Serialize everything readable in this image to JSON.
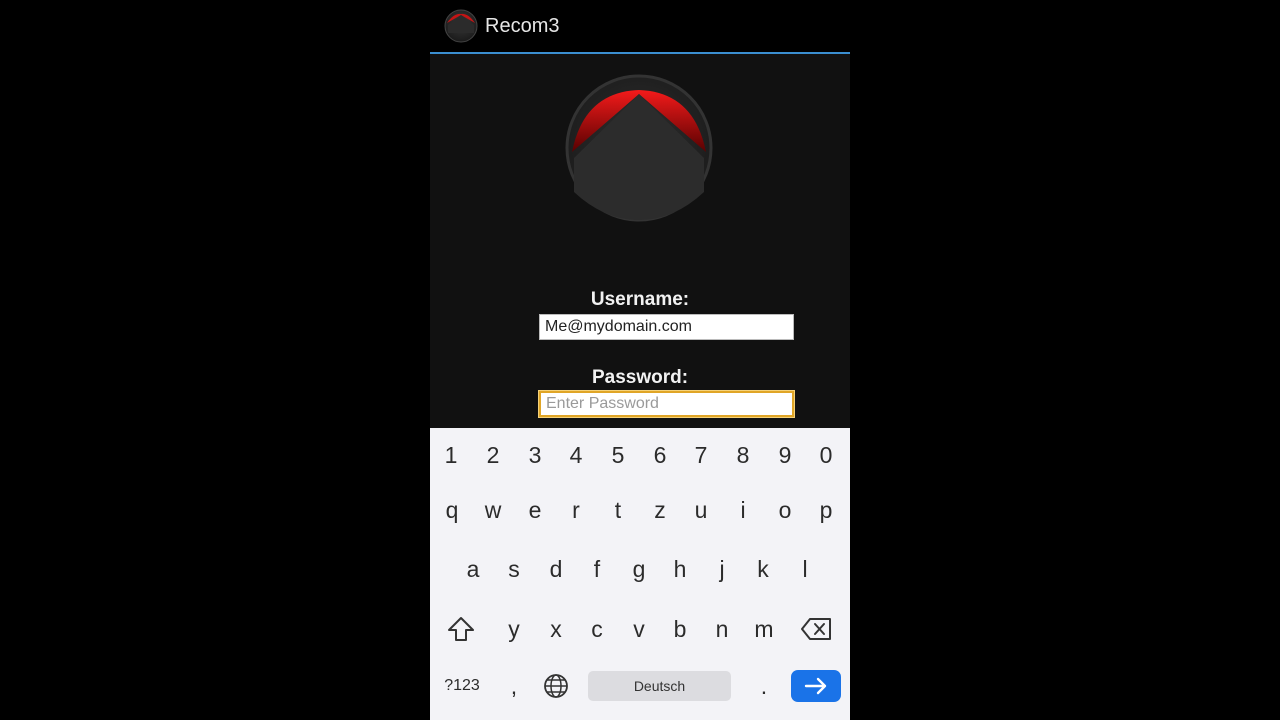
{
  "app": {
    "title": "Recom3",
    "accent_color": "#3b8fd1"
  },
  "login": {
    "username_label": "Username:",
    "username_value": "Me@mydomain.com",
    "password_label": "Password:",
    "password_placeholder": "Enter Password",
    "password_focus_color": "#e0a526"
  },
  "keyboard": {
    "row_numbers": [
      "1",
      "2",
      "3",
      "4",
      "5",
      "6",
      "7",
      "8",
      "9",
      "0"
    ],
    "row_1": [
      "q",
      "w",
      "e",
      "r",
      "t",
      "z",
      "u",
      "i",
      "o",
      "p"
    ],
    "row_2": [
      "a",
      "s",
      "d",
      "f",
      "g",
      "h",
      "j",
      "k",
      "l"
    ],
    "row_3": [
      "y",
      "x",
      "c",
      "v",
      "b",
      "n",
      "m"
    ],
    "shift_icon": "shift-icon",
    "backspace_icon": "backspace-icon",
    "symbols_label": "?123",
    "comma_label": ",",
    "globe_icon": "globe-icon",
    "space_label": "Deutsch",
    "period_label": ".",
    "enter_icon": "arrow-right-icon",
    "enter_color": "#1a73e8"
  }
}
